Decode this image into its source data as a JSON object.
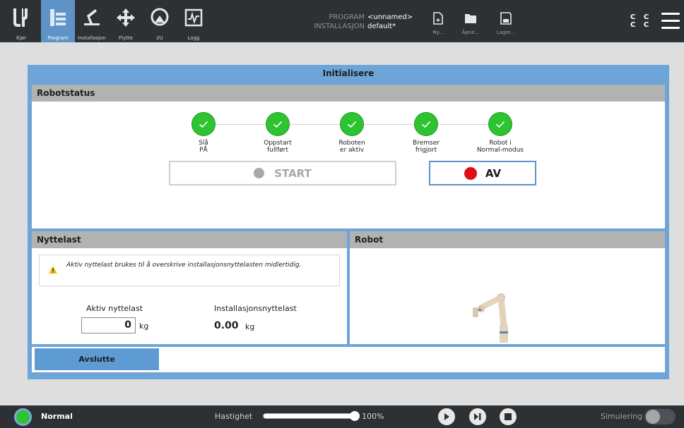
{
  "topbar": {
    "nav": [
      {
        "label": "Kjør",
        "icon": "ur-logo-icon"
      },
      {
        "label": "Program",
        "icon": "program-icon",
        "active": true
      },
      {
        "label": "Installasjon",
        "icon": "installation-icon"
      },
      {
        "label": "Flytte",
        "icon": "move-icon"
      },
      {
        "label": "I/U",
        "icon": "io-icon"
      },
      {
        "label": "Logg",
        "icon": "log-icon"
      }
    ],
    "program_key": "PROGRAM",
    "program_value": "<unnamed>",
    "installation_key": "INSTALLASJON",
    "installation_value": "default*",
    "file_actions": [
      {
        "label": "Ny...",
        "icon": "new-file-icon"
      },
      {
        "label": "Åpne...",
        "icon": "open-folder-icon"
      },
      {
        "label": "Lagre...",
        "icon": "save-icon"
      }
    ],
    "cc_top": "C C",
    "cc_bottom": "C C"
  },
  "dialog": {
    "title": "Initialisere",
    "robotstatus": {
      "header": "Robotstatus",
      "steps": [
        {
          "label": "Slå\nPÅ",
          "done": true
        },
        {
          "label": "Oppstart\nfullført",
          "done": true
        },
        {
          "label": "Roboten\ner aktiv",
          "done": true
        },
        {
          "label": "Bremser\nfrigjort",
          "done": true
        },
        {
          "label": "Robot i\nNormal-modus",
          "done": true
        }
      ],
      "start_label": "START",
      "off_label": "AV"
    },
    "payload": {
      "header": "Nyttelast",
      "note": "Aktiv nyttelast brukes til å overskrive installasjonsnyttelasten midlertidig.",
      "active_label": "Aktiv nyttelast",
      "active_value": "0",
      "active_unit": "kg",
      "install_label": "Installasjonsnyttelast",
      "install_value": "0.00",
      "install_unit": "kg"
    },
    "robot": {
      "header": "Robot"
    },
    "exit_label": "Avslutte"
  },
  "bottombar": {
    "status": "Normal",
    "speed_label": "Hastighet",
    "speed_value": "100%",
    "speed_fraction": 1.0,
    "simulation_label": "Simulering",
    "simulation_on": false
  },
  "colors": {
    "accent": "#5f93c7",
    "ok_green": "#2ec431",
    "off_red": "#e10c16",
    "topbar_bg": "#2e3134"
  }
}
